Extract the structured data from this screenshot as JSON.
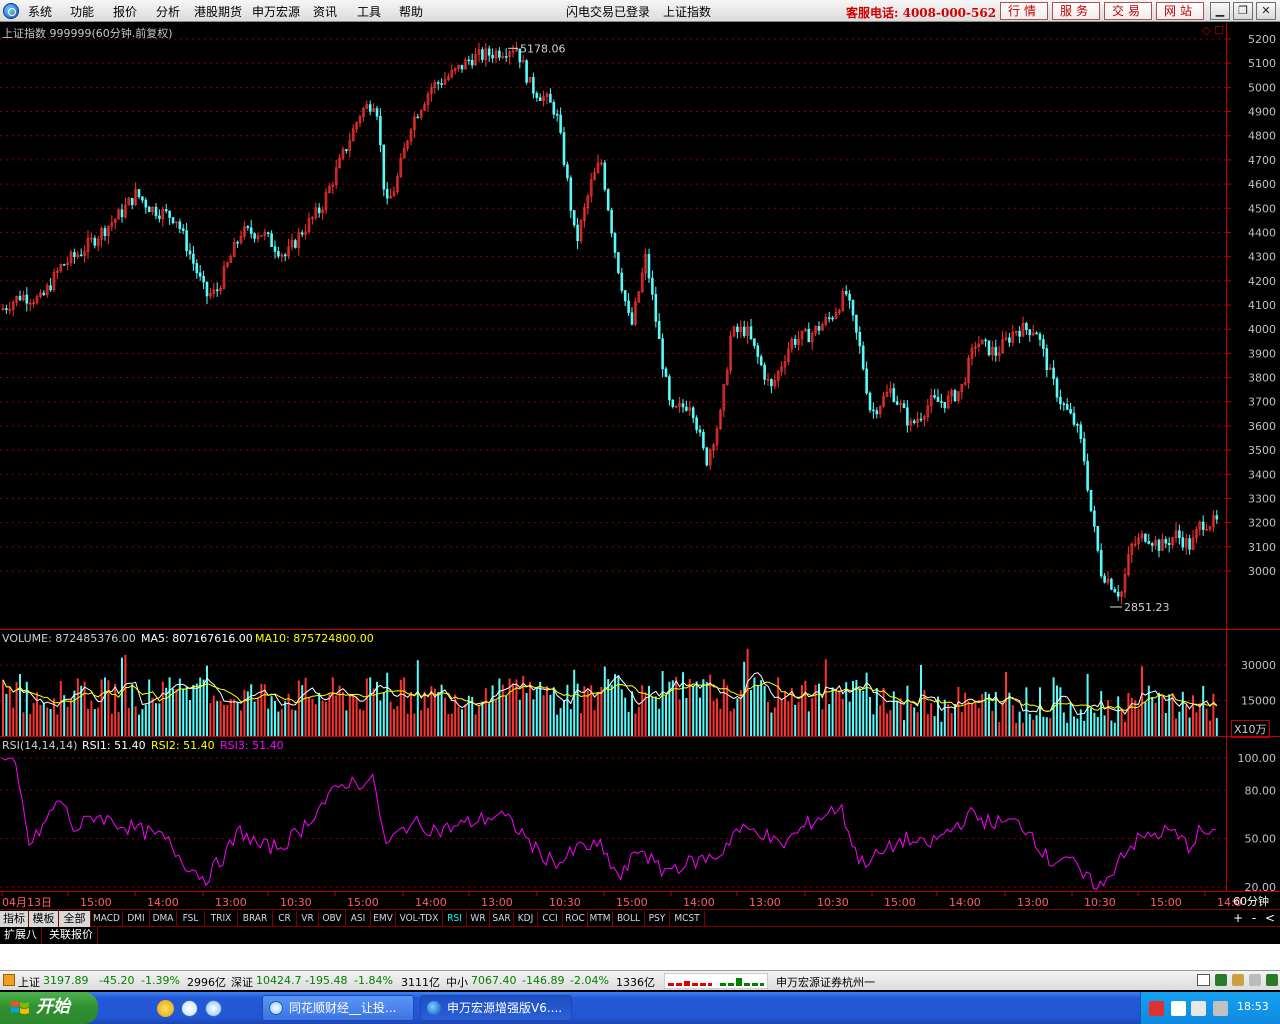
{
  "menu": {
    "items": [
      "系统",
      "功能",
      "报价",
      "分析",
      "港股期货",
      "申万宏源",
      "资讯",
      "工具",
      "帮助"
    ],
    "login_status": "闪电交易已登录",
    "current_symbol": "上证指数",
    "hotline": "客服电话: 4008-000-562",
    "nav_buttons": [
      "行情",
      "服务",
      "交易",
      "网站"
    ],
    "window_buttons": [
      "▁",
      "❐",
      "✕"
    ]
  },
  "chart": {
    "header": "上证指数 999999(60分钟.前复权)",
    "corner_marks": "◇ ☐",
    "max_label": "5178.06",
    "min_label": "2851.23",
    "price_ticks": [
      "5200",
      "5100",
      "5000",
      "4900",
      "4800",
      "4700",
      "4600",
      "4500",
      "4400",
      "4300",
      "4200",
      "4100",
      "4000",
      "3900",
      "3800",
      "3700",
      "3600",
      "3500",
      "3400",
      "3300",
      "3200",
      "3100",
      "3000"
    ],
    "volume_header": {
      "volume_label": "VOLUME: 872485376.00",
      "ma5_label": "MA5: 807167616.00",
      "ma10_label": "MA10: 875724800.00"
    },
    "volume_ticks": [
      "30000",
      "15000"
    ],
    "volume_unit": "X10万",
    "rsi_header": {
      "name": "RSI(14,14,14)",
      "rsi1": "RSI1: 51.40",
      "rsi2": "RSI2: 51.40",
      "rsi3": "RSI3: 51.40"
    },
    "rsi_ticks": [
      "100.00",
      "80.00",
      "50.00",
      "20.00"
    ],
    "time_labels": [
      "04月13日",
      "15:00",
      "14:00",
      "13:00",
      "10:30",
      "15:00",
      "14:00",
      "13:00",
      "10:30",
      "15:00",
      "14:00",
      "13:00",
      "10:30",
      "15:00",
      "14:00",
      "13:00",
      "10:30",
      "15:00",
      "14:0"
    ],
    "period": "60分钟",
    "colors": {
      "up": "#ff3232",
      "down": "#54fcfc",
      "grid": "#8b0000",
      "ma5": "#ffffff",
      "ma10": "#ffff00",
      "rsi": "#ff00ff",
      "axis": "#c00000"
    }
  },
  "indicator_tabs": [
    "指标",
    "模板",
    "全部",
    "MACD",
    "DMI",
    "DMA",
    "FSL",
    "TRIX",
    "BRAR",
    "CR",
    "VR",
    "OBV",
    "ASI",
    "EMV",
    "VOL-TDX",
    "RSI",
    "WR",
    "SAR",
    "KDJ",
    "CCI",
    "ROC",
    "MTM",
    "BOLL",
    "PSY",
    "MCST"
  ],
  "active_indicator": "RSI",
  "zoom_buttons": [
    "+",
    "-",
    "<"
  ],
  "extend_tabs": [
    "扩展八",
    "关联报价"
  ],
  "status": {
    "sh_name": "上证",
    "sh_value": "3197.89",
    "sh_change": "-45.20",
    "sh_pct": "-1.39%",
    "sh_amount": "2996亿",
    "sz_name": "深证",
    "sz_value": "10424.7",
    "sz_change": "-195.48",
    "sz_pct": "-1.84%",
    "sz_amount": "3111亿",
    "zx_name": "中小",
    "zx_value": "7067.40",
    "zx_change": "-146.89",
    "zx_pct": "-2.04%",
    "zx_amount": "1336亿",
    "broker": "申万宏源证券杭州一"
  },
  "taskbar": {
    "start_label": "开始",
    "tasks": [
      "同花顺财经__让投...",
      "申万宏源增强版V6...."
    ],
    "clock": "18:53"
  }
}
